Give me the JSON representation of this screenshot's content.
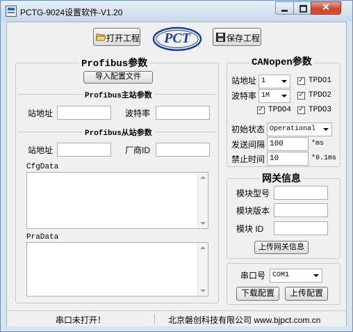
{
  "window": {
    "title": "PCTG-9024设置软件-V1.20"
  },
  "toolbar": {
    "open_label": "打开工程",
    "save_label": "保存工程",
    "logo_text": "PCT"
  },
  "profibus": {
    "title": "Profibus参数",
    "import_button": "导入配置文件",
    "master_header": "Profibus主站参数",
    "station_label": "站地址",
    "baud_label": "波特率",
    "station_value": "",
    "baud_value": "",
    "slave_header": "Profibus从站参数",
    "slave_station_label": "站地址",
    "vendor_label": "厂商ID",
    "slave_station_value": "",
    "vendor_value": "",
    "cfg_label": "CfgData",
    "pra_label": "PraData"
  },
  "canopen": {
    "title": "CANopen参数",
    "station_label": "站地址",
    "station_value": "1",
    "baud_label": "波特率",
    "baud_value": "1M",
    "tpdo1": "TPDO1",
    "tpdo2": "TPDO2",
    "tpdo3": "TPDO3",
    "tpdo4": "TPDO4",
    "init_label": "初始状态",
    "init_value": "Operational",
    "send_label": "发送间隔",
    "send_value": "100",
    "send_unit": "*ms",
    "inhibit_label": "禁止时间",
    "inhibit_value": "10",
    "inhibit_unit": "*0.1ms"
  },
  "gateway": {
    "title": "网关信息",
    "model_label": "模块型号",
    "version_label": "模块版本",
    "id_label": "模块 ID",
    "upload_button": "上传网关信息"
  },
  "serial": {
    "port_label": "串口号",
    "port_value": "COM1",
    "download_button": "下载配置",
    "upload_button": "上传配置"
  },
  "status": {
    "port_status": "串口未打开！",
    "company": "北京磐创科技有限公司 www.bjpct.com.cn"
  },
  "colors": {
    "logo_blue": "#1b3f9b",
    "title_bar": "#c9d8ea",
    "close_red": "#c7472e"
  }
}
